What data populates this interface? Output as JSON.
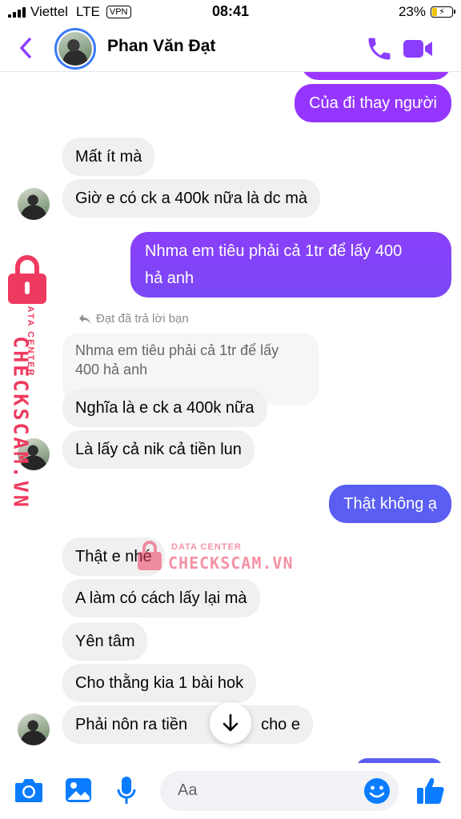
{
  "status": {
    "carrier": "Viettel",
    "network": "LTE",
    "vpn": "VPN",
    "time": "08:41",
    "battery": "23%",
    "battery_level": 0.23
  },
  "header": {
    "contact_name": "Phan Văn Đạt"
  },
  "colors": {
    "accent": "#8b3dff",
    "bubble_out_top": "#a033ff",
    "bubble_out_bottom": "#5b5cf0",
    "bubble_in": "#f0f0f0"
  },
  "messages": {
    "m1": "Của đi thay người",
    "m2": "Mất ít mà",
    "m3": "Giờ e có ck a 400k nữa là dc mà",
    "m4_line1": "Nhma em tiêu phải cả 1tr để lấy 400",
    "m4_line2": "hả anh",
    "reply_label": "Đạt đã trả lời bạn",
    "quoted_line1": "Nhma em tiêu phải cả 1tr để lấy",
    "quoted_line2": "400 hả anh",
    "m5": "Nghĩa là e ck a 400k nữa",
    "m6": "Là lấy cả nik cả tiền lun",
    "m7": "Thật không ạ",
    "m8": "Thật e nhé",
    "m9": "A làm có cách lấy lại mà",
    "m10": "Yên tâm",
    "m11": "Cho thằng kia 1 bài hok",
    "m12": "Phải nôn ra tiền",
    "m12_tail": "cho e"
  },
  "watermark": {
    "brand": "CHECKSCAM.VN",
    "tagline": "DATA CENTER"
  },
  "composer": {
    "placeholder": "Aa"
  }
}
